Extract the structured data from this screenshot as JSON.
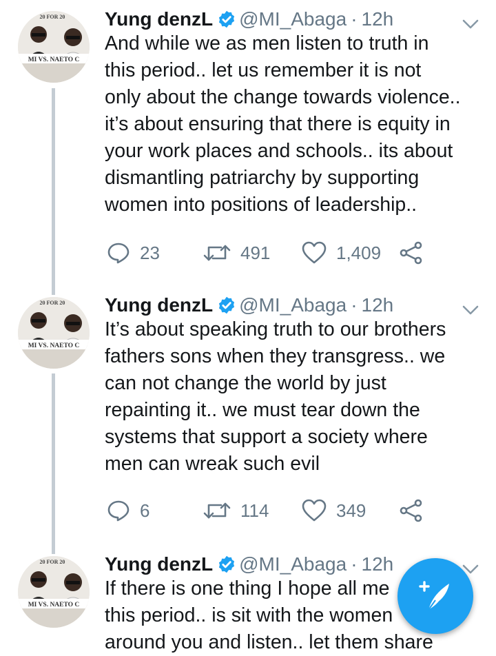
{
  "tweets": [
    {
      "name": "Yung denzL",
      "handle": "@MI_Abaga",
      "time": "12h",
      "lines": [
        "And while we as men listen to truth in",
        "this period.. let us remember it is not",
        "only about the change towards violence..",
        "it’s about ensuring that there is equity in",
        "your work places and schools.. its about",
        "dismantling patriarchy by supporting",
        "women into positions of leadership.."
      ],
      "replies": "23",
      "retweets": "491",
      "likes": "1,409"
    },
    {
      "name": "Yung denzL",
      "handle": "@MI_Abaga",
      "time": "12h",
      "lines": [
        "It’s about speaking truth to our brothers",
        "fathers sons when they transgress.. we",
        "can not change the world by just",
        "repainting it.. we must tear down the",
        "systems that support a society where",
        "men can wreak such evil"
      ],
      "replies": "6",
      "retweets": "114",
      "likes": "349"
    },
    {
      "name": "Yung denzL",
      "handle": "@MI_Abaga",
      "time": "12h",
      "lines": [
        "If there is one thing I hope all me",
        "this period.. is sit with the women",
        "around you and listen.. let them share"
      ]
    }
  ],
  "avatar": {
    "top_text": "20 FOR 20",
    "banner_text": "MI VS. NAETO C"
  },
  "colors": {
    "accent": "#1da1f2",
    "text": "#14171a",
    "muted": "#657786",
    "thread_line": "#c4ccd3"
  },
  "icons": [
    "verified-icon",
    "chevron-down-icon",
    "reply-icon",
    "retweet-icon",
    "like-icon",
    "share-icon",
    "compose-icon"
  ]
}
